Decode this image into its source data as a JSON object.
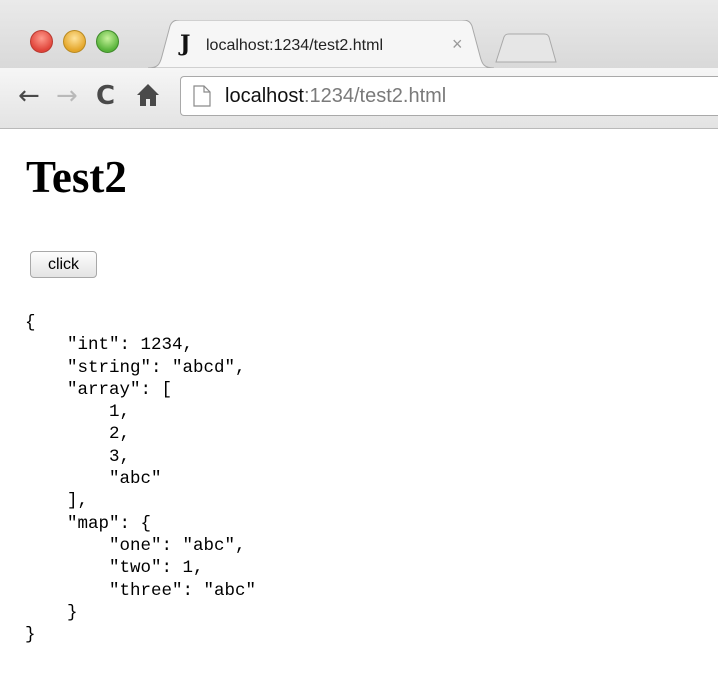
{
  "browser": {
    "window_controls": {
      "close_color": "#e0443a",
      "minimize_color": "#e4a62a",
      "maximize_color": "#58b33a"
    },
    "tab": {
      "favicon_glyph": "J",
      "title": "localhost:1234/test2.html",
      "close_glyph": "×"
    },
    "toolbar": {
      "back_glyph": "←",
      "forward_glyph": "→",
      "reload_glyph": "C",
      "home_glyph": "🏠"
    },
    "address_bar": {
      "host": "localhost",
      "rest": ":1234/test2.html"
    }
  },
  "page": {
    "heading": "Test2",
    "button_label": "click",
    "json_output": "{\n    \"int\": 1234,\n    \"string\": \"abcd\",\n    \"array\": [\n        1,\n        2,\n        3,\n        \"abc\"\n    ],\n    \"map\": {\n        \"one\": \"abc\",\n        \"two\": 1,\n        \"three\": \"abc\"\n    }\n}"
  }
}
